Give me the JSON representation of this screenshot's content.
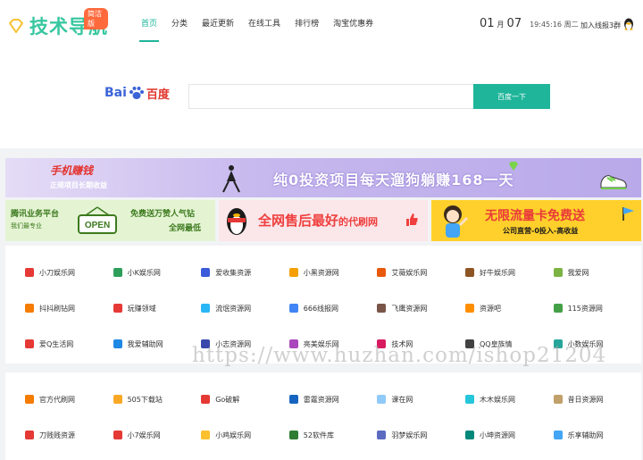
{
  "header": {
    "logo_text": "技术导航",
    "logo_badge": "简洁版",
    "nav": [
      {
        "label": "首页",
        "active": true
      },
      {
        "label": "分类",
        "active": false
      },
      {
        "label": "最近更新",
        "active": false
      },
      {
        "label": "在线工具",
        "active": false
      },
      {
        "label": "排行榜",
        "active": false
      },
      {
        "label": "淘宝优惠券",
        "active": false
      }
    ],
    "date_month": "01",
    "date_month_unit": "月",
    "date_day": "07",
    "time": "19:45:16 周二",
    "qq_group": "加入线报3群"
  },
  "search": {
    "engine_bai": "Bai",
    "engine_du": "百度",
    "placeholder": "",
    "button": "百度一下"
  },
  "banners": {
    "top_left_1": "手机赚钱",
    "top_left_2": "正规项目长期收益",
    "top_main": "纯0投资项目每天遛狗躺赚168一天",
    "b1_a": "腾讯业务平台",
    "b1_b": "我们最专业",
    "b1_c": "免费送万赞人气钻",
    "b1_d": "全网最低",
    "b1_sign": "OPEN",
    "b2_a": "全网",
    "b2_b": "售后最好",
    "b2_c": "的代刷网",
    "b3_a": "无限流量卡免费送",
    "b3_b": "公司直营-0投入-高收益"
  },
  "group1": [
    {
      "label": "小刀娱乐网",
      "color": "#e53935"
    },
    {
      "label": "小K娱乐网",
      "color": "#2e9e5b"
    },
    {
      "label": "爱收集资源",
      "color": "#3b5bdb"
    },
    {
      "label": "小黑资源网",
      "color": "#f59f00"
    },
    {
      "label": "艾薇娱乐网",
      "color": "#e8590c"
    },
    {
      "label": "好牛娱乐网",
      "color": "#8d5524"
    },
    {
      "label": "我爱网",
      "color": "#7cb342"
    },
    {
      "label": "抖抖刷钻网",
      "color": "#f57c00"
    },
    {
      "label": "玩赚领域",
      "color": "#e53935"
    },
    {
      "label": "流氓资源网",
      "color": "#29b6f6"
    },
    {
      "label": "666线报网",
      "color": "#4285f4"
    },
    {
      "label": "飞鹰资源网",
      "color": "#795548"
    },
    {
      "label": "资源吧",
      "color": "#ff8f00"
    },
    {
      "label": "115资源网",
      "color": "#43a047"
    },
    {
      "label": "爱Q生活网",
      "color": "#e53935"
    },
    {
      "label": "我爱辅助网",
      "color": "#1e88e5"
    },
    {
      "label": "小志资源网",
      "color": "#3949ab"
    },
    {
      "label": "亮美娱乐网",
      "color": "#ab47bc"
    },
    {
      "label": "技术网",
      "color": "#d81b60"
    },
    {
      "label": "QQ皇族情",
      "color": "#424242"
    },
    {
      "label": "小数娱乐网",
      "color": "#26a69a"
    }
  ],
  "group2": [
    {
      "label": "官方代刷网",
      "color": "#f57c00"
    },
    {
      "label": "505下载站",
      "color": "#f9a825"
    },
    {
      "label": "Go破解",
      "color": "#e53935"
    },
    {
      "label": "雷霆资源网",
      "color": "#1565c0"
    },
    {
      "label": "课在网",
      "color": "#90caf9"
    },
    {
      "label": "木木娱乐网",
      "color": "#26c6da"
    },
    {
      "label": "昔日资源网",
      "color": "#c0a16b"
    },
    {
      "label": "刀贱贱资源",
      "color": "#e53935"
    },
    {
      "label": "小7娱乐网",
      "color": "#e53935"
    },
    {
      "label": "小鸡娱乐网",
      "color": "#fbc02d"
    },
    {
      "label": "52软件库",
      "color": "#2e7d32"
    },
    {
      "label": "羽梦娱乐网",
      "color": "#5c6bc0"
    },
    {
      "label": "小坤资源网",
      "color": "#00897b"
    },
    {
      "label": "乐享辅助网",
      "color": "#42a5f5"
    }
  ],
  "watermark": "https://www.huzhan.com/ishop21204"
}
